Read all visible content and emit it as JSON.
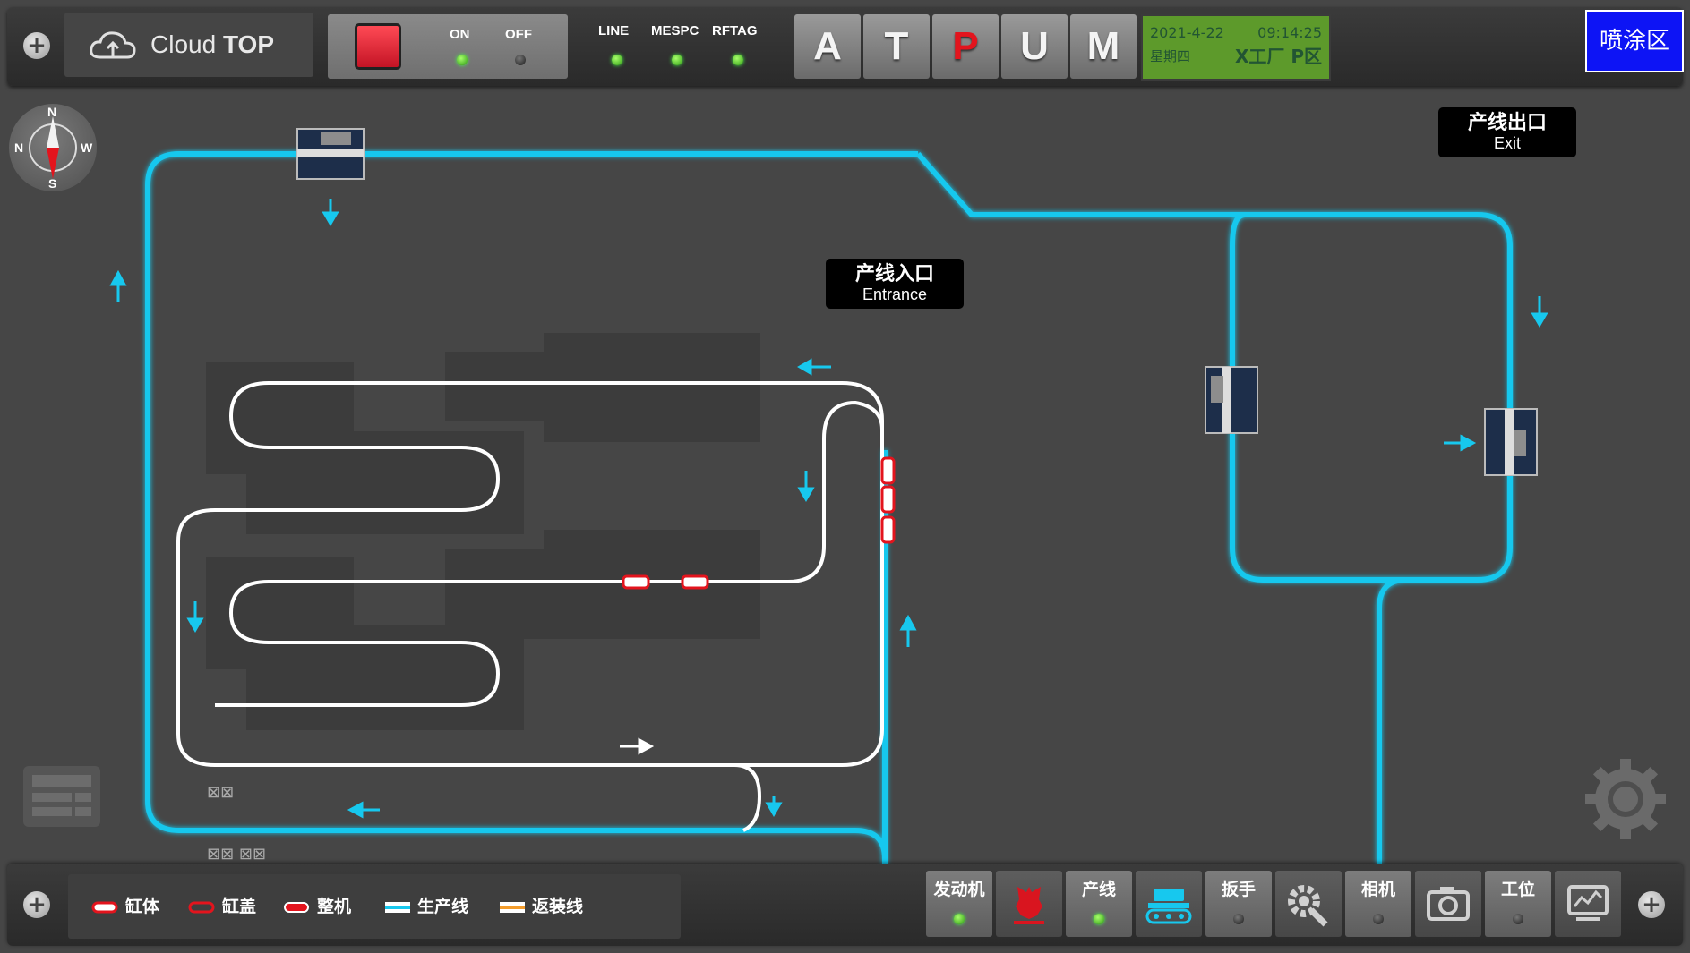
{
  "header": {
    "logo_text_light": "Cloud ",
    "logo_text_bold": "TOP",
    "switch": {
      "on_label": "ON",
      "off_label": "OFF"
    },
    "status": [
      {
        "label": "LINE",
        "state": "green"
      },
      {
        "label": "MESPC",
        "state": "green"
      },
      {
        "label": "RFTAG",
        "state": "green"
      }
    ],
    "modes": [
      {
        "letter": "A",
        "active": false
      },
      {
        "letter": "T",
        "active": false
      },
      {
        "letter": "P",
        "active": true
      },
      {
        "letter": "U",
        "active": false
      },
      {
        "letter": "M",
        "active": false
      }
    ],
    "datetime": {
      "date": "2021-4-22",
      "time": "09:14:25",
      "weekday": "星期四",
      "zone": "X工厂 P区"
    },
    "area_button": "喷涂区"
  },
  "map": {
    "exit_sign": {
      "cn": "产线出口",
      "en": "Exit"
    },
    "entrance_sign": {
      "cn": "产线入口",
      "en": "Entrance"
    },
    "compass": {
      "n": "N",
      "w": "W",
      "s": "S",
      "left": "N"
    },
    "small_marks": [
      "⊠⊠",
      "⊠⊠ ⊠⊠"
    ],
    "colors": {
      "main_line": "#17c8ee",
      "return_line": "#ffffff",
      "part": "#e3141d"
    }
  },
  "legend": [
    {
      "label": "缸体",
      "swatch": "red-outline"
    },
    {
      "label": "缸盖",
      "swatch": "red-ring"
    },
    {
      "label": "整机",
      "swatch": "red-solid"
    },
    {
      "label": "生产线",
      "swatch": "cyan-line"
    },
    {
      "label": "返装线",
      "swatch": "orange-line"
    }
  ],
  "toolbar": [
    {
      "label": "发动机",
      "led": "green"
    },
    {
      "icon": "engine-icon"
    },
    {
      "label": "产线",
      "led": "green"
    },
    {
      "icon": "conveyor-icon"
    },
    {
      "label": "扳手",
      "led": "off"
    },
    {
      "icon": "wrench-gear-icon"
    },
    {
      "label": "相机",
      "led": "off"
    },
    {
      "icon": "camera-icon"
    },
    {
      "label": "工位",
      "led": "off"
    },
    {
      "icon": "monitor-chart-icon"
    }
  ]
}
